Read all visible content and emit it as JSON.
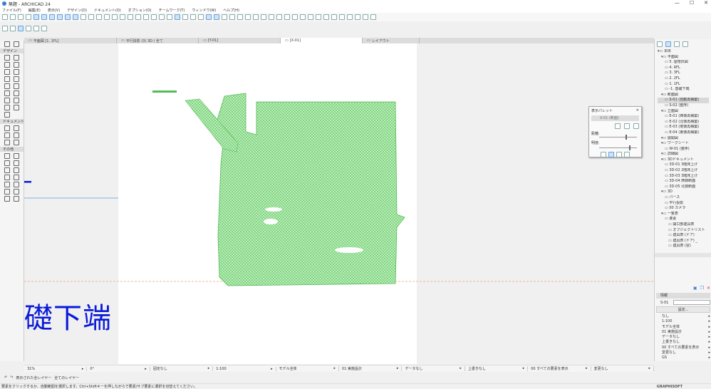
{
  "window": {
    "title": "無題 - ARCHICAD 24",
    "controls": [
      "—",
      "☐",
      "✕"
    ]
  },
  "menu": [
    "ファイル(F)",
    "編集(E)",
    "表示(V)",
    "デザイン(D)",
    "ドキュメント(O)",
    "オプション(O)",
    "チームワーク(T)",
    "ウィンドウ(W)",
    "ヘルプ(H)"
  ],
  "tabs": [
    {
      "label": "平面図 [1. 1FL]"
    },
    {
      "label": "平行投影 (3) 3D / 全て"
    },
    {
      "label": "[Y-01]"
    },
    {
      "label": "[X-01]",
      "active": true
    },
    {
      "label": "レイアウト"
    }
  ],
  "toolbox": {
    "sections": [
      "デザイン",
      "ドキュメント",
      "その他"
    ]
  },
  "canvas": {
    "label": "礎下端",
    "cloud_color": "#7ed87e",
    "level_line_color": "#f0a080"
  },
  "palette": {
    "title": "表示パレット",
    "view": "X-01 (断面)",
    "label_a": "距離:",
    "label_b": "明度:"
  },
  "navigator": {
    "items": [
      {
        "label": "本体",
        "depth": 0
      },
      {
        "label": "平面図",
        "depth": 1
      },
      {
        "label": "5. 屋根伏図",
        "depth": 2
      },
      {
        "label": "4. RFL",
        "depth": 2
      },
      {
        "label": "3. 3FL",
        "depth": 2
      },
      {
        "label": "2. 2FL",
        "depth": 2
      },
      {
        "label": "1. 1FL",
        "depth": 2
      },
      {
        "label": "-1. 基礎下端",
        "depth": 2
      },
      {
        "label": "断面図",
        "depth": 1
      },
      {
        "label": "S-01 (自動再構築)",
        "depth": 2,
        "selected": true
      },
      {
        "label": "S-02 (整序)",
        "depth": 2
      },
      {
        "label": "立面図",
        "depth": 1
      },
      {
        "label": "E-01 (西側再構築)",
        "depth": 2
      },
      {
        "label": "E-02 (北側再構築)",
        "depth": 2
      },
      {
        "label": "E-03 (南側再構築)",
        "depth": 2
      },
      {
        "label": "E-04 (東側再構築)",
        "depth": 2
      },
      {
        "label": "展開図",
        "depth": 1
      },
      {
        "label": "ワークシート",
        "depth": 1
      },
      {
        "label": "W-01 (整序)",
        "depth": 2
      },
      {
        "label": "詳細図",
        "depth": 1
      },
      {
        "label": "3Dドキュメント",
        "depth": 1
      },
      {
        "label": "3D-01 3階床上げ",
        "depth": 2
      },
      {
        "label": "3D-02 2階床上げ",
        "depth": 2
      },
      {
        "label": "3D-03 3階床上げ",
        "depth": 2
      },
      {
        "label": "3D-04 西側断面",
        "depth": 2
      },
      {
        "label": "3D-05 北側断面",
        "depth": 2
      },
      {
        "label": "3D",
        "depth": 1
      },
      {
        "label": "パース",
        "depth": 2
      },
      {
        "label": "平行投影",
        "depth": 2
      },
      {
        "label": "00 カメラ",
        "depth": 2
      },
      {
        "label": "一覧表",
        "depth": 1
      },
      {
        "label": "要素",
        "depth": 2
      },
      {
        "label": "開口部建具表",
        "depth": 3
      },
      {
        "label": "オブジェクトリスト",
        "depth": 3
      },
      {
        "label": "建具表 (ドア)",
        "depth": 3
      },
      {
        "label": "建具表 (ドア) _",
        "depth": 3
      },
      {
        "label": "建具表 (窓)",
        "depth": 3
      }
    ]
  },
  "properties": {
    "header": "情報",
    "id": "S-01",
    "settings_button": "設定...",
    "rows": [
      "なし",
      "1:100",
      "モデル全体",
      "01 実施設計",
      "データなし",
      "上書きなし",
      "00 すべての要素を表示",
      "変更なし",
      "GS"
    ]
  },
  "canvasbar": [
    "31%",
    "0°",
    "固定なし",
    "1:100",
    "モデル全体",
    "01 実施設計",
    "データなし",
    "上書きなし",
    "00 すべての要素を表示",
    "変更なし"
  ],
  "layerbar": {
    "a": "表示された全レイヤー",
    "b": "全てのレイヤー"
  },
  "status": {
    "message": "要素をクリックするか、自動範囲を選択します。Ctrl+Shiftキーを押しながらで要素/サブ要素に選択を切替えてください。",
    "brand": "GRAPHISOFT"
  }
}
